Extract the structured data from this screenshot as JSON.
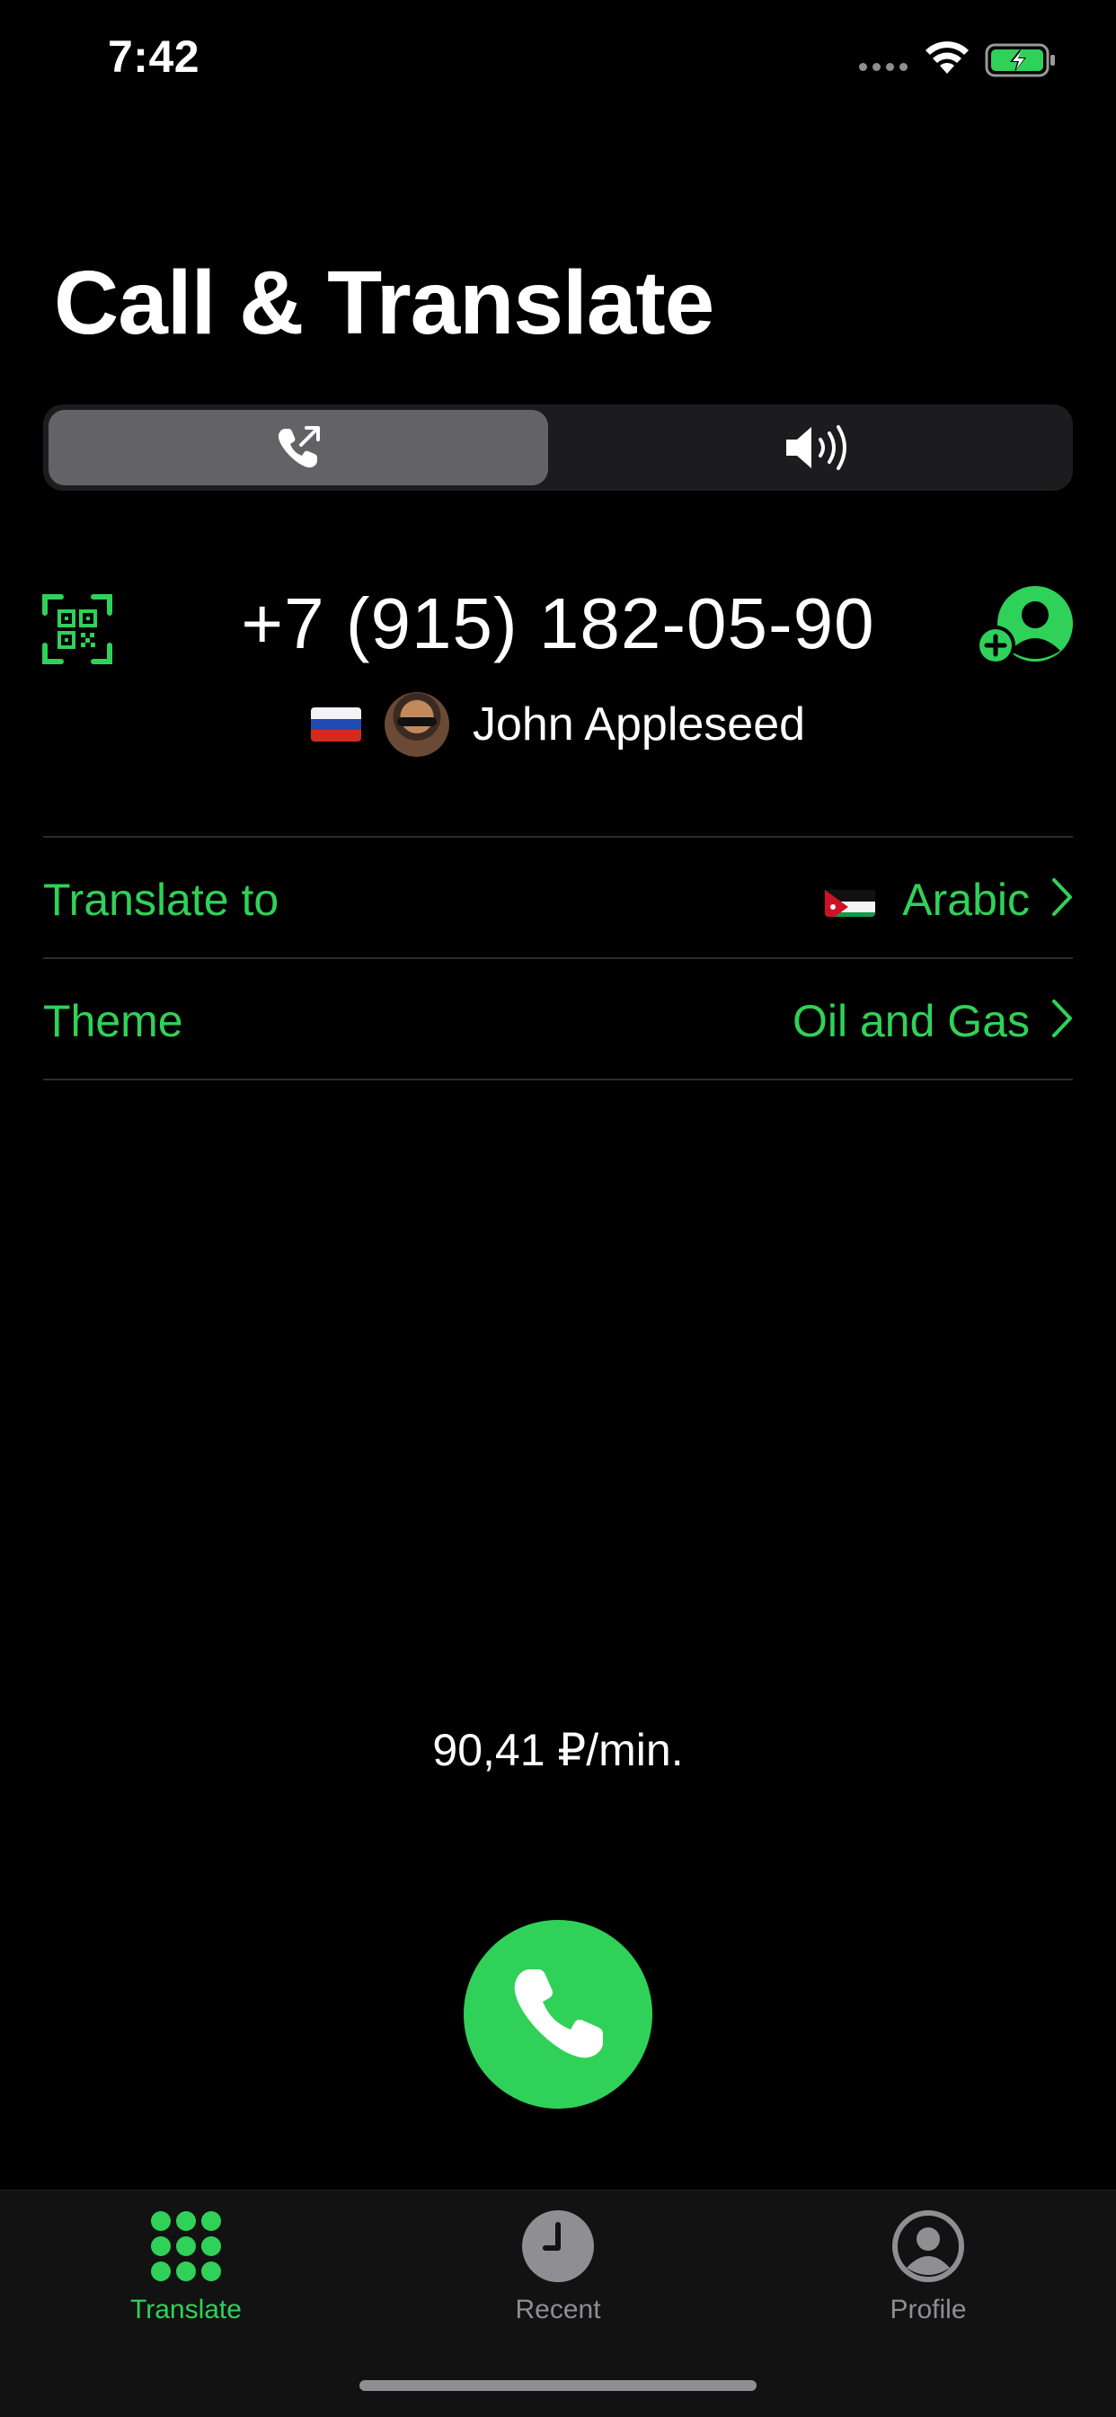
{
  "status_bar": {
    "time": "7:42",
    "icons": [
      "cellular-signal-icon",
      "wifi-icon",
      "battery-charging-icon"
    ]
  },
  "header": {
    "title": "Call & Translate"
  },
  "mode_selector": {
    "options": [
      {
        "icon": "phone-outgoing-icon",
        "selected": true
      },
      {
        "icon": "speaker-icon",
        "selected": false
      }
    ]
  },
  "call_target": {
    "phone_number": "+7 (915) 182-05-90",
    "country_flag": "russia-flag",
    "contact_name": "John Appleseed",
    "left_icon": "qr-scan-icon",
    "right_icon": "add-contact-icon"
  },
  "settings": {
    "translate_to": {
      "label": "Translate to",
      "value": "Arabic",
      "flag": "jordan-flag"
    },
    "theme": {
      "label": "Theme",
      "value": "Oil and Gas"
    }
  },
  "price": "90,41 ₽/min.",
  "call_button": {
    "icon": "phone-icon"
  },
  "tab_bar": {
    "tabs": [
      {
        "label": "Translate",
        "icon": "keypad-icon",
        "active": true
      },
      {
        "label": "Recent",
        "icon": "clock-icon",
        "active": false
      },
      {
        "label": "Profile",
        "icon": "person-circle-icon",
        "active": false
      }
    ]
  },
  "colors": {
    "accent": "#30d158",
    "background": "#000000",
    "segment_selected": "#636366",
    "segment_track": "#1c1c1e",
    "inactive": "#8e8e93"
  }
}
